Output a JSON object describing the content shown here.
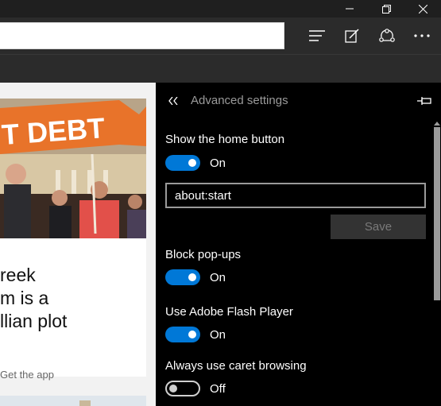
{
  "window": {
    "minimize_icon": "minimize-icon",
    "restore_icon": "restore-icon",
    "close_icon": "close-icon"
  },
  "toolbar": {
    "address_value": "",
    "hub_icon": "hub-icon",
    "notes_icon": "web-note-icon",
    "share_icon": "share-icon",
    "more_icon": "more-icon"
  },
  "page": {
    "banner_text": "T DEBT",
    "headline": "reek\nm is a\nllian plot",
    "get_app": "Get the app"
  },
  "settings": {
    "title": "Advanced settings",
    "back_icon": "double-chevron-left-icon",
    "pin_icon": "pin-icon",
    "home_button": {
      "label": "Show the home button",
      "state": "On",
      "on": true
    },
    "home_url": "about:start",
    "save_label": "Save",
    "popups": {
      "label": "Block pop-ups",
      "state": "On",
      "on": true
    },
    "flash": {
      "label": "Use Adobe Flash Player",
      "state": "On",
      "on": true
    },
    "caret": {
      "label": "Always use caret browsing",
      "state": "Off",
      "on": false
    }
  },
  "colors": {
    "accent": "#0078d7",
    "pane_bg": "#000000",
    "toolbar_bg": "#2b2b2b"
  }
}
